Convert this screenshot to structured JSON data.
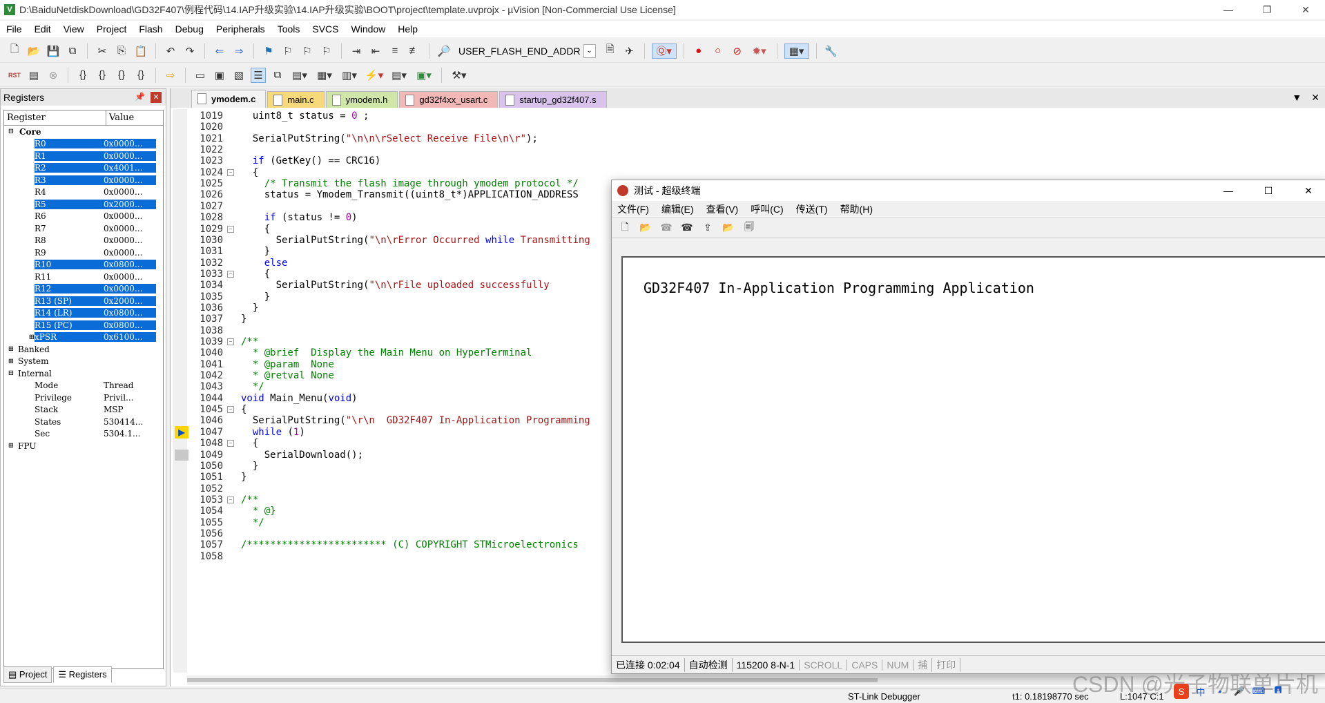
{
  "window": {
    "title": "D:\\BaiduNetdiskDownload\\GD32F407\\例程代码\\14.IAP升级实验\\14.IAP升级实验\\BOOT\\project\\template.uvprojx - µVision  [Non-Commercial Use License]",
    "app_icon": "V",
    "minimize": "—",
    "maximize": "❐",
    "close": "✕"
  },
  "menu": [
    "File",
    "Edit",
    "View",
    "Project",
    "Flash",
    "Debug",
    "Peripherals",
    "Tools",
    "SVCS",
    "Window",
    "Help"
  ],
  "toolbar": {
    "target_combo": "USER_FLASH_END_ADDR",
    "rst_label": "RST"
  },
  "registers_panel": {
    "title": "Registers",
    "col_register": "Register",
    "col_value": "Value",
    "groups": {
      "core": "Core",
      "banked": "Banked",
      "system": "System",
      "internal": "Internal",
      "fpu": "FPU"
    },
    "core_regs": [
      {
        "name": "R0",
        "value": "0x0000...",
        "sel": true
      },
      {
        "name": "R1",
        "value": "0x0000...",
        "sel": true
      },
      {
        "name": "R2",
        "value": "0x4001...",
        "sel": true
      },
      {
        "name": "R3",
        "value": "0x0000...",
        "sel": true
      },
      {
        "name": "R4",
        "value": "0x0000...",
        "sel": false
      },
      {
        "name": "R5",
        "value": "0x2000...",
        "sel": true
      },
      {
        "name": "R6",
        "value": "0x0000...",
        "sel": false
      },
      {
        "name": "R7",
        "value": "0x0000...",
        "sel": false
      },
      {
        "name": "R8",
        "value": "0x0000...",
        "sel": false
      },
      {
        "name": "R9",
        "value": "0x0000...",
        "sel": false
      },
      {
        "name": "R10",
        "value": "0x0800...",
        "sel": true
      },
      {
        "name": "R11",
        "value": "0x0000...",
        "sel": false
      },
      {
        "name": "R12",
        "value": "0x0000...",
        "sel": true
      },
      {
        "name": "R13 (SP)",
        "value": "0x2000...",
        "sel": true
      },
      {
        "name": "R14 (LR)",
        "value": "0x0800...",
        "sel": true
      },
      {
        "name": "R15 (PC)",
        "value": "0x0800...",
        "sel": true
      },
      {
        "name": "xPSR",
        "value": "0x6100...",
        "sel": true
      }
    ],
    "internal_regs": [
      {
        "name": "Mode",
        "value": "Thread"
      },
      {
        "name": "Privilege",
        "value": "Privil..."
      },
      {
        "name": "Stack",
        "value": "MSP"
      },
      {
        "name": "States",
        "value": "530414..."
      },
      {
        "name": "Sec",
        "value": "5304.1..."
      }
    ],
    "tab_project": "Project",
    "tab_registers": "Registers"
  },
  "editor": {
    "tabs": [
      {
        "label": "ymodem.c",
        "color": "#f3f3f3",
        "active": true
      },
      {
        "label": "main.c",
        "color": "#f5d97a",
        "active": false
      },
      {
        "label": "ymodem.h",
        "color": "#cfe6a8",
        "active": false
      },
      {
        "label": "gd32f4xx_usart.c",
        "color": "#f2b8b8",
        "active": false
      },
      {
        "label": "startup_gd32f407.s",
        "color": "#d9c2ec",
        "active": false
      }
    ],
    "dropdown": "▼",
    "close": "✕",
    "lines": [
      {
        "n": "1019",
        "t": "  uint8_t status = 0 ;"
      },
      {
        "n": "1020",
        "t": ""
      },
      {
        "n": "1021",
        "t": "  SerialPutString(\"\\n\\n\\rSelect Receive File\\n\\r\");"
      },
      {
        "n": "1022",
        "t": ""
      },
      {
        "n": "1023",
        "t": "  if (GetKey() == CRC16)"
      },
      {
        "n": "1024",
        "t": "  {"
      },
      {
        "n": "1025",
        "t": "    /* Transmit the flash image through ymodem protocol */"
      },
      {
        "n": "1026",
        "t": "    status = Ymodem_Transmit((uint8_t*)APPLICATION_ADDRESS"
      },
      {
        "n": "1027",
        "t": ""
      },
      {
        "n": "1028",
        "t": "    if (status != 0)"
      },
      {
        "n": "1029",
        "t": "    {"
      },
      {
        "n": "1030",
        "t": "      SerialPutString(\"\\n\\rError Occurred while Transmitting"
      },
      {
        "n": "1031",
        "t": "    }"
      },
      {
        "n": "1032",
        "t": "    else"
      },
      {
        "n": "1033",
        "t": "    {"
      },
      {
        "n": "1034",
        "t": "      SerialPutString(\"\\n\\rFile uploaded successfully"
      },
      {
        "n": "1035",
        "t": "    }"
      },
      {
        "n": "1036",
        "t": "  }"
      },
      {
        "n": "1037",
        "t": "}"
      },
      {
        "n": "1038",
        "t": ""
      },
      {
        "n": "1039",
        "t": "/**"
      },
      {
        "n": "1040",
        "t": "  * @brief  Display the Main Menu on HyperTerminal"
      },
      {
        "n": "1041",
        "t": "  * @param  None"
      },
      {
        "n": "1042",
        "t": "  * @retval None"
      },
      {
        "n": "1043",
        "t": "  */"
      },
      {
        "n": "1044",
        "t": "void Main_Menu(void)"
      },
      {
        "n": "1045",
        "t": "{"
      },
      {
        "n": "1046",
        "t": "  SerialPutString(\"\\r\\n  GD32F407 In-Application Programming"
      },
      {
        "n": "1047",
        "t": "  while (1)"
      },
      {
        "n": "1048",
        "t": "  {"
      },
      {
        "n": "1049",
        "t": "    SerialDownload();"
      },
      {
        "n": "1050",
        "t": "  }"
      },
      {
        "n": "1051",
        "t": "}"
      },
      {
        "n": "1052",
        "t": ""
      },
      {
        "n": "1053",
        "t": "/**"
      },
      {
        "n": "1054",
        "t": "  * @}"
      },
      {
        "n": "1055",
        "t": "  */"
      },
      {
        "n": "1056",
        "t": ""
      },
      {
        "n": "1057",
        "t": "/************************ (C) COPYRIGHT STMicroelectronics"
      },
      {
        "n": "1058",
        "t": ""
      }
    ]
  },
  "hyperterminal": {
    "title": "测试 - 超级终端",
    "minimize": "—",
    "maximize": "☐",
    "close": "✕",
    "menu": [
      "文件(F)",
      "编辑(E)",
      "查看(V)",
      "呼叫(C)",
      "传送(T)",
      "帮助(H)"
    ],
    "output": "GD32F407 In-Application Programming Application",
    "status": {
      "connected": "已连接 0:02:04",
      "detect": "自动检测",
      "baud": "115200 8-N-1",
      "scroll": "SCROLL",
      "caps": "CAPS",
      "num": "NUM",
      "capture": "捕",
      "print": "打印"
    }
  },
  "statusbar": {
    "debugger": "ST-Link Debugger",
    "time": "t1: 0.18198770 sec",
    "position": "L:1047 C:1"
  },
  "watermark": "CSDN @光子物联单片机",
  "tray": [
    "S",
    "中",
    "•",
    "🎤",
    "⌨",
    "🖪"
  ]
}
